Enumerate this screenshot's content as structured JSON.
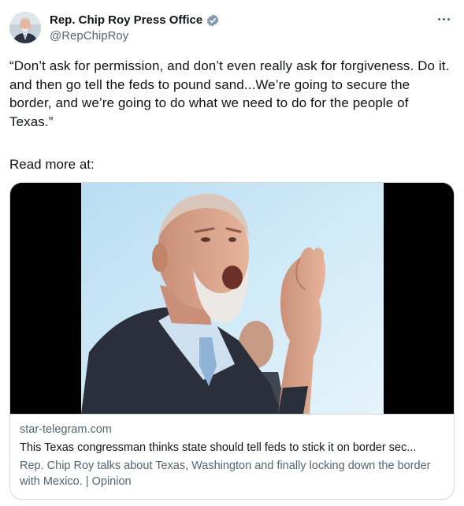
{
  "author": {
    "display_name": "Rep. Chip Roy Press Office",
    "handle": "@RepChipRoy",
    "verified_color": "#829aab"
  },
  "tweet": {
    "text": "“Don’t ask for permission, and don’t even really ask for forgiveness. Do it. and then go tell the feds to pound sand...We’re going to secure the border, and we’re going to do what we need to do for the people of Texas.”",
    "read_more": "Read more at:"
  },
  "card": {
    "domain": "star-telegram.com",
    "title": "This Texas congressman thinks state should tell feds to stick it on border sec...",
    "description": "Rep. Chip Roy talks about Texas, Washington and finally locking down the border with Mexico. | Opinion"
  },
  "icons": {
    "more": "more-options-icon",
    "verified": "verified-badge-icon"
  },
  "colors": {
    "text_primary": "#0f1419",
    "text_secondary": "#536471",
    "border": "#cfd9de"
  }
}
